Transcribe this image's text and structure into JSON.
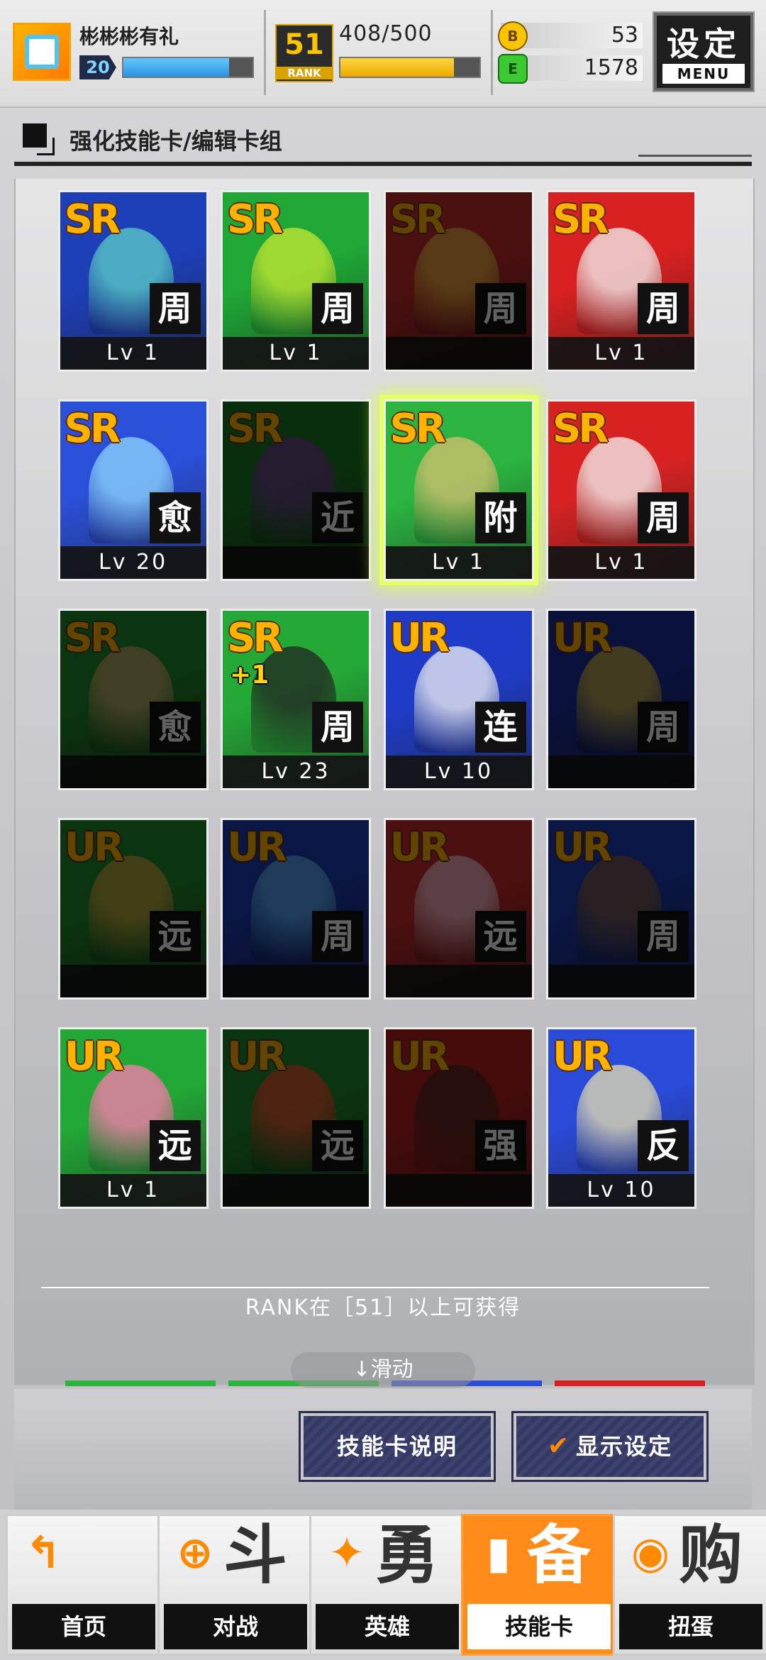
{
  "header": {
    "player_name": "彬彬彬有礼",
    "player_level": "20",
    "exp_fraction": 0.82,
    "rank": {
      "label": "RANK",
      "value": "51",
      "progress_text": "408/500",
      "fraction": 0.816
    },
    "currency": [
      {
        "icon": "gold-coin-icon",
        "symbol": "B",
        "value": "53"
      },
      {
        "icon": "green-energy-icon",
        "symbol": "E",
        "value": "1578"
      }
    ],
    "menu": {
      "top": "设定",
      "bottom": "MENU"
    }
  },
  "section_title": "强化技能卡/编辑卡组",
  "cards": [
    {
      "rarity": "SR",
      "type": "周",
      "level": "Lv 1",
      "owned": true,
      "color": "#1d3fb8",
      "accent": "#5ad0c8"
    },
    {
      "rarity": "SR",
      "type": "周",
      "level": "Lv 1",
      "owned": true,
      "color": "#1fa836",
      "accent": "#c8e830"
    },
    {
      "rarity": "SR",
      "type": "周",
      "level": "",
      "owned": false,
      "color": "#c42a2a",
      "accent": "#f2c040"
    },
    {
      "rarity": "SR",
      "type": "周",
      "level": "Lv 1",
      "owned": true,
      "color": "#d82020",
      "accent": "#f2f2f2"
    },
    {
      "rarity": "SR",
      "type": "愈",
      "level": "Lv 20",
      "owned": true,
      "color": "#2a4fd8",
      "accent": "#8fd8ff"
    },
    {
      "rarity": "SR",
      "type": "近",
      "level": "",
      "owned": false,
      "color": "#1a7a22",
      "accent": "#7a3a9a"
    },
    {
      "rarity": "SR",
      "type": "附",
      "level": "Lv 1",
      "owned": true,
      "color": "#2bb540",
      "accent": "#d8c070",
      "selected": true
    },
    {
      "rarity": "SR",
      "type": "周",
      "level": "Lv 1",
      "owned": true,
      "color": "#d82222",
      "accent": "#f4f4f4"
    },
    {
      "rarity": "SR",
      "type": "愈",
      "level": "",
      "owned": false,
      "color": "#1e8a2a",
      "accent": "#d8b070"
    },
    {
      "rarity": "SR",
      "plus": "+1",
      "type": "周",
      "level": "Lv 23",
      "owned": true,
      "color": "#24a836",
      "accent": "#222222"
    },
    {
      "rarity": "UR",
      "type": "连",
      "level": "Lv 10",
      "owned": true,
      "color": "#1f3cc8",
      "accent": "#f2f2f2"
    },
    {
      "rarity": "UR",
      "type": "周",
      "level": "",
      "owned": false,
      "color": "#1b2f9a",
      "accent": "#e0c040"
    },
    {
      "rarity": "UR",
      "type": "远",
      "level": "",
      "owned": false,
      "color": "#1e8a2a",
      "accent": "#e0b040"
    },
    {
      "rarity": "UR",
      "type": "周",
      "level": "",
      "owned": false,
      "color": "#1b3ab0",
      "accent": "#60c0ff"
    },
    {
      "rarity": "UR",
      "type": "远",
      "level": "",
      "owned": false,
      "color": "#c82a2a",
      "accent": "#ffd0e0"
    },
    {
      "rarity": "UR",
      "type": "周",
      "level": "",
      "owned": false,
      "color": "#1b3ab0",
      "accent": "#8a6040"
    },
    {
      "rarity": "UR",
      "type": "远",
      "level": "Lv 1",
      "owned": true,
      "color": "#22a836",
      "accent": "#ff7ab0"
    },
    {
      "rarity": "UR",
      "type": "远",
      "level": "",
      "owned": false,
      "color": "#1e8a2a",
      "accent": "#ff5030"
    },
    {
      "rarity": "UR",
      "type": "强",
      "level": "",
      "owned": false,
      "color": "#b82020",
      "accent": "#4a2a20"
    },
    {
      "rarity": "UR",
      "type": "反",
      "level": "Lv 10",
      "owned": true,
      "color": "#2a4ad8",
      "accent": "#e8e0b0"
    }
  ],
  "rank_unlock_note": "RANK在［51］以上可获得",
  "scroll_hint": "↓滑动",
  "actions": {
    "skill_card_info": "技能卡说明",
    "display_settings": "显示设定"
  },
  "nav": [
    {
      "icon": "arrow-back-icon",
      "glyph": "↰",
      "big": "",
      "label": "首页",
      "active": false
    },
    {
      "icon": "gamepad-icon",
      "glyph": "⊕",
      "big": "斗",
      "label": "对战",
      "active": false
    },
    {
      "icon": "hero-icon",
      "glyph": "✦",
      "big": "勇",
      "label": "英雄",
      "active": false
    },
    {
      "icon": "card-deck-icon",
      "glyph": "▮",
      "big": "备",
      "label": "技能卡",
      "active": true
    },
    {
      "icon": "gacha-capsule-icon",
      "glyph": "◉",
      "big": "购",
      "label": "扭蛋",
      "active": false
    }
  ],
  "colors": {
    "accent_orange": "#ff8c1a",
    "rank_gold": "#ffc400",
    "exp_blue": "#2a93e0",
    "select_glow": "#e6ff66"
  }
}
